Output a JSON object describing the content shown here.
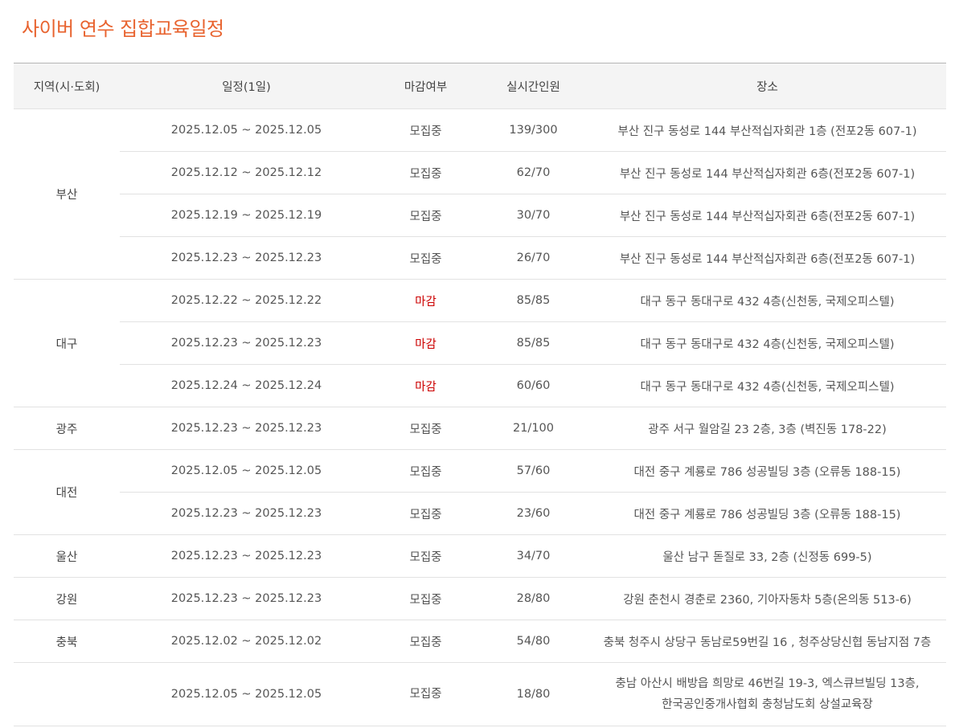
{
  "title": "사이버 연수 집합교육일정",
  "colors": {
    "title": "#e8632f",
    "closed": "#cc0000"
  },
  "table": {
    "headers": [
      "지역(시·도회)",
      "일정(1일)",
      "마감여부",
      "실시간인원",
      "장소"
    ],
    "groups": [
      {
        "region": "부산",
        "rows": [
          {
            "date": "2025.12.05 ~ 2025.12.05",
            "status": "모집중",
            "closed": false,
            "count": "139/300",
            "place": "부산 진구 동성로 144 부산적십자회관 1층 (전포2동 607-1)"
          },
          {
            "date": "2025.12.12 ~ 2025.12.12",
            "status": "모집중",
            "closed": false,
            "count": "62/70",
            "place": "부산 진구 동성로 144 부산적십자회관 6층(전포2동 607-1)"
          },
          {
            "date": "2025.12.19 ~ 2025.12.19",
            "status": "모집중",
            "closed": false,
            "count": "30/70",
            "place": "부산 진구 동성로 144 부산적십자회관 6층(전포2동 607-1)"
          },
          {
            "date": "2025.12.23 ~ 2025.12.23",
            "status": "모집중",
            "closed": false,
            "count": "26/70",
            "place": "부산 진구 동성로 144 부산적십자회관 6층(전포2동 607-1)"
          }
        ]
      },
      {
        "region": "대구",
        "rows": [
          {
            "date": "2025.12.22 ~ 2025.12.22",
            "status": "마감",
            "closed": true,
            "count": "85/85",
            "place": "대구 동구 동대구로 432 4층(신천동, 국제오피스텔)"
          },
          {
            "date": "2025.12.23 ~ 2025.12.23",
            "status": "마감",
            "closed": true,
            "count": "85/85",
            "place": "대구 동구 동대구로 432 4층(신천동, 국제오피스텔)"
          },
          {
            "date": "2025.12.24 ~ 2025.12.24",
            "status": "마감",
            "closed": true,
            "count": "60/60",
            "place": "대구 동구 동대구로 432 4층(신천동, 국제오피스텔)"
          }
        ]
      },
      {
        "region": "광주",
        "rows": [
          {
            "date": "2025.12.23 ~ 2025.12.23",
            "status": "모집중",
            "closed": false,
            "count": "21/100",
            "place": "광주 서구 월암길 23 2층, 3층 (벽진동 178-22)"
          }
        ]
      },
      {
        "region": "대전",
        "rows": [
          {
            "date": "2025.12.05 ~ 2025.12.05",
            "status": "모집중",
            "closed": false,
            "count": "57/60",
            "place": "대전 중구 계룡로 786 성공빌딩 3층 (오류동 188-15)"
          },
          {
            "date": "2025.12.23 ~ 2025.12.23",
            "status": "모집중",
            "closed": false,
            "count": "23/60",
            "place": "대전 중구 계룡로 786 성공빌딩 3층 (오류동 188-15)"
          }
        ]
      },
      {
        "region": "울산",
        "rows": [
          {
            "date": "2025.12.23 ~ 2025.12.23",
            "status": "모집중",
            "closed": false,
            "count": "34/70",
            "place": "울산 남구 돋질로 33, 2층 (신정동 699-5)"
          }
        ]
      },
      {
        "region": "강원",
        "rows": [
          {
            "date": "2025.12.23 ~ 2025.12.23",
            "status": "모집중",
            "closed": false,
            "count": "28/80",
            "place": "강원 춘천시 경춘로 2360, 기아자동차 5층(온의동 513-6)"
          }
        ]
      },
      {
        "region": "충북",
        "rows": [
          {
            "date": "2025.12.02 ~ 2025.12.02",
            "status": "모집중",
            "closed": false,
            "count": "54/80",
            "place": "충북 청주시 상당구 동남로59번길 16 , 청주상당신협 동남지점 7층"
          }
        ]
      },
      {
        "region": "",
        "rows": [
          {
            "date": "2025.12.05 ~ 2025.12.05",
            "status": "모집중",
            "closed": false,
            "count": "18/80",
            "place": "충남 아산시 배방읍 희망로 46번길 19-3, 엑스큐브빌딩 13층,",
            "place2": "한국공인중개사협회 충청남도회 상설교육장"
          }
        ]
      }
    ]
  }
}
